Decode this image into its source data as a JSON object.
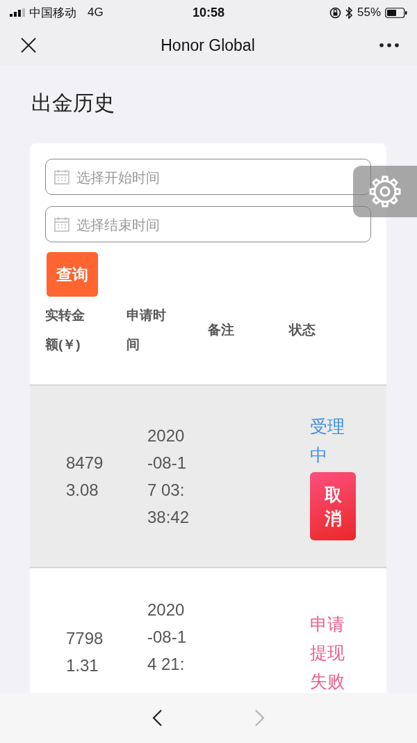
{
  "status_bar": {
    "carrier": "中国移动",
    "network": "4G",
    "time": "10:58",
    "battery": "55%"
  },
  "nav_bar": {
    "title": "Honor Global"
  },
  "page": {
    "title": "出金历史"
  },
  "filters": [
    {
      "placeholder": "选择开始时间"
    },
    {
      "placeholder": "选择结束时间"
    }
  ],
  "query_button": "查询",
  "table": {
    "columns": [
      "实转金额(￥)",
      "申请时间",
      "备注",
      "状态"
    ],
    "rows": [
      {
        "amount": "84793.08",
        "time": "2020-08-17 03:38:42",
        "status": "受理中",
        "kind": "processing",
        "highlighted": true,
        "action": "取消"
      },
      {
        "amount": "77981.31",
        "time": "2020-08-14 21:",
        "status": "申请提现失败",
        "kind": "failed",
        "highlighted": false
      }
    ]
  },
  "bottom_bar": {
    "back_disabled": false,
    "forward_disabled": true
  }
}
